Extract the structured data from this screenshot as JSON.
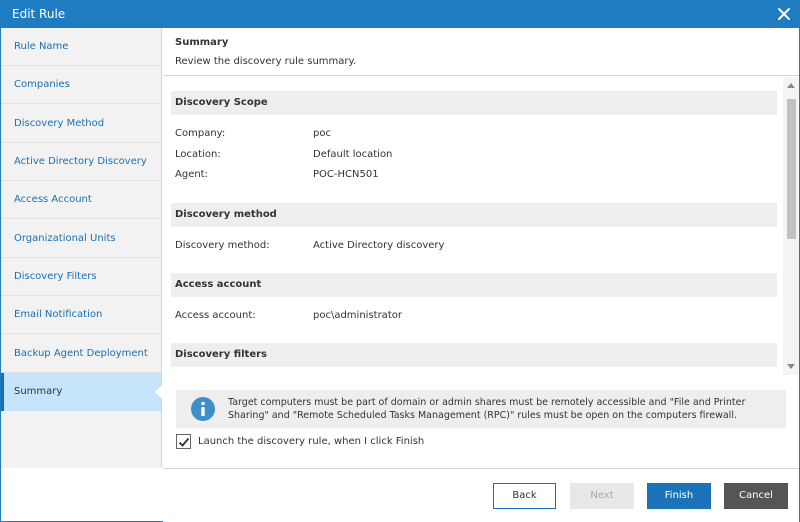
{
  "window": {
    "title": "Edit Rule"
  },
  "sidebar": {
    "items": [
      {
        "label": "Rule Name"
      },
      {
        "label": "Companies"
      },
      {
        "label": "Discovery Method"
      },
      {
        "label": "Active Directory Discovery"
      },
      {
        "label": "Access Account"
      },
      {
        "label": "Organizational Units"
      },
      {
        "label": "Discovery Filters"
      },
      {
        "label": "Email Notification"
      },
      {
        "label": "Backup Agent Deployment"
      },
      {
        "label": "Summary",
        "active": true
      }
    ]
  },
  "header": {
    "title": "Summary",
    "subtitle": "Review the discovery rule summary."
  },
  "summary": {
    "scope": {
      "title": "Discovery Scope",
      "company_label": "Company:",
      "company_value": "poc",
      "location_label": "Location:",
      "location_value": "Default location",
      "agent_label": "Agent:",
      "agent_value": "POC-HCN501"
    },
    "method": {
      "title": "Discovery method",
      "label": "Discovery method:",
      "value": "Active Directory discovery"
    },
    "access": {
      "title": "Access account",
      "label": "Access account:",
      "value": "poc\\administrator"
    },
    "filters": {
      "title": "Discovery filters"
    }
  },
  "info": {
    "icon": "info-icon",
    "message": "Target computers must be part of domain or admin shares must be remotely accessible and \"File and Printer Sharing\" and \"Remote Scheduled Tasks Management (RPC)\" rules must be open on the computers firewall."
  },
  "launch": {
    "label": "Launch the discovery rule, when I click Finish",
    "checked": true
  },
  "buttons": {
    "back": "Back",
    "next": "Next",
    "finish": "Finish",
    "cancel": "Cancel"
  },
  "colors": {
    "accent": "#1f7cc1",
    "active_nav": "#c5e3f9",
    "cancel": "#555555"
  }
}
